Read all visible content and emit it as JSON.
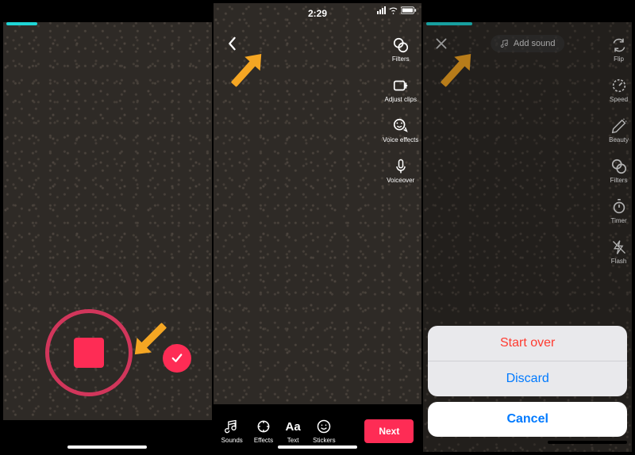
{
  "screen1": {
    "progress_pct": 15,
    "record_label": "record",
    "confirm_label": "confirm"
  },
  "screen2": {
    "time": "2:29",
    "back_label": "back",
    "side_tools": [
      {
        "icon": "filters-icon",
        "label": "Filters"
      },
      {
        "icon": "adjust-clips-icon",
        "label": "Adjust clips"
      },
      {
        "icon": "voice-effects-icon",
        "label": "Voice effects"
      },
      {
        "icon": "voiceover-icon",
        "label": "Voiceover"
      }
    ],
    "bottom_tools": [
      {
        "icon": "sounds-icon",
        "label": "Sounds"
      },
      {
        "icon": "effects-icon",
        "label": "Effects"
      },
      {
        "icon": "text-icon",
        "label": "Text",
        "glyph": "Aa"
      },
      {
        "icon": "stickers-icon",
        "label": "Stickers"
      }
    ],
    "next_label": "Next"
  },
  "screen3": {
    "progress_pct": 22,
    "close_label": "close",
    "add_sound_label": "Add sound",
    "side_tools": [
      {
        "icon": "flip-icon",
        "label": "Flip"
      },
      {
        "icon": "speed-icon",
        "label": "Speed"
      },
      {
        "icon": "beauty-icon",
        "label": "Beauty"
      },
      {
        "icon": "filters-icon",
        "label": "Filters"
      },
      {
        "icon": "timer-icon",
        "label": "Timer"
      },
      {
        "icon": "flash-icon",
        "label": "Flash"
      }
    ],
    "sheet": {
      "start_over": "Start over",
      "discard": "Discard",
      "cancel": "Cancel"
    }
  },
  "colors": {
    "accent": "#fe2c55",
    "teal": "#1fd6d6",
    "destructive": "#ff3b30",
    "link": "#007aff"
  }
}
